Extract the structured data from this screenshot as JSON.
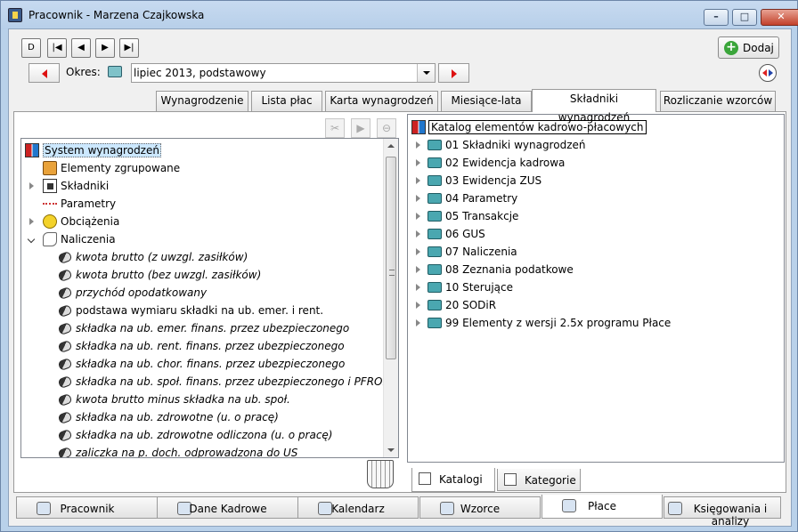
{
  "window": {
    "title": "Pracownik - Marzena Czajkowska"
  },
  "toolbar": {
    "nav": [
      "D",
      "|◀",
      "◀",
      "▶",
      "▶|"
    ],
    "add_label": "Dodaj"
  },
  "period": {
    "label": "Okres:",
    "value": "lipiec 2013, podstawowy"
  },
  "tabs": [
    "Wynagrodzenie",
    "Lista płac",
    "Karta wynagrodzeń",
    "Miesiące-lata",
    "Składniki wynagrodzeń",
    "Rozliczanie wzorców"
  ],
  "left_tree": {
    "items": [
      {
        "label": "System wynagrodzeń",
        "icon": "system-icon"
      },
      {
        "label": "Elementy zgrupowane",
        "icon": "group-icon"
      },
      {
        "label": "Składniki",
        "icon": "components-icon"
      },
      {
        "label": "Parametry",
        "icon": "parameters-icon"
      },
      {
        "label": "Obciążenia",
        "icon": "charges-icon"
      },
      {
        "label": "Naliczenia",
        "icon": "calculations-icon"
      },
      {
        "label": "kwota brutto (z uwzgl. zasiłków)"
      },
      {
        "label": "kwota brutto (bez uwzgl. zasiłków)"
      },
      {
        "label": "przychód opodatkowany"
      },
      {
        "label": "podstawa wymiaru składki na ub. emer. i rent."
      },
      {
        "label": "składka na ub. emer. finans. przez ubezpieczonego"
      },
      {
        "label": "składka na ub. rent. finans. przez ubezpieczonego"
      },
      {
        "label": "składka na ub. chor. finans. przez ubezpieczonego"
      },
      {
        "label": "składka na ub. społ. finans. przez ubezpieczonego i PFRON"
      },
      {
        "label": "kwota brutto minus składka na ub. społ."
      },
      {
        "label": "składka na ub. zdrowotne (u. o pracę)"
      },
      {
        "label": "składka na ub. zdrowotne odliczona (u. o pracę)"
      },
      {
        "label": "zaliczka na p. doch. odprowadzona do US"
      }
    ]
  },
  "right_tree": {
    "root": "Katalog elementów kadrowo-płacowych",
    "items": [
      "01 Składniki wynagrodzeń",
      "02 Ewidencja kadrowa",
      "03 Ewidencja ZUS",
      "04 Parametry",
      "05 Transakcje",
      "06 GUS",
      "07 Naliczenia",
      "08 Zeznania podatkowe",
      "10 Sterujące",
      "20 SODiR",
      "99 Elementy z wersji 2.5x programu Płace"
    ]
  },
  "subtabs": [
    "Katalogi",
    "Kategorie"
  ],
  "bottom_tabs": [
    "Pracownik",
    "Dane Kadrowe",
    "Kalendarz",
    "Wzorce",
    "Płace",
    "Księgowania i analizy"
  ]
}
